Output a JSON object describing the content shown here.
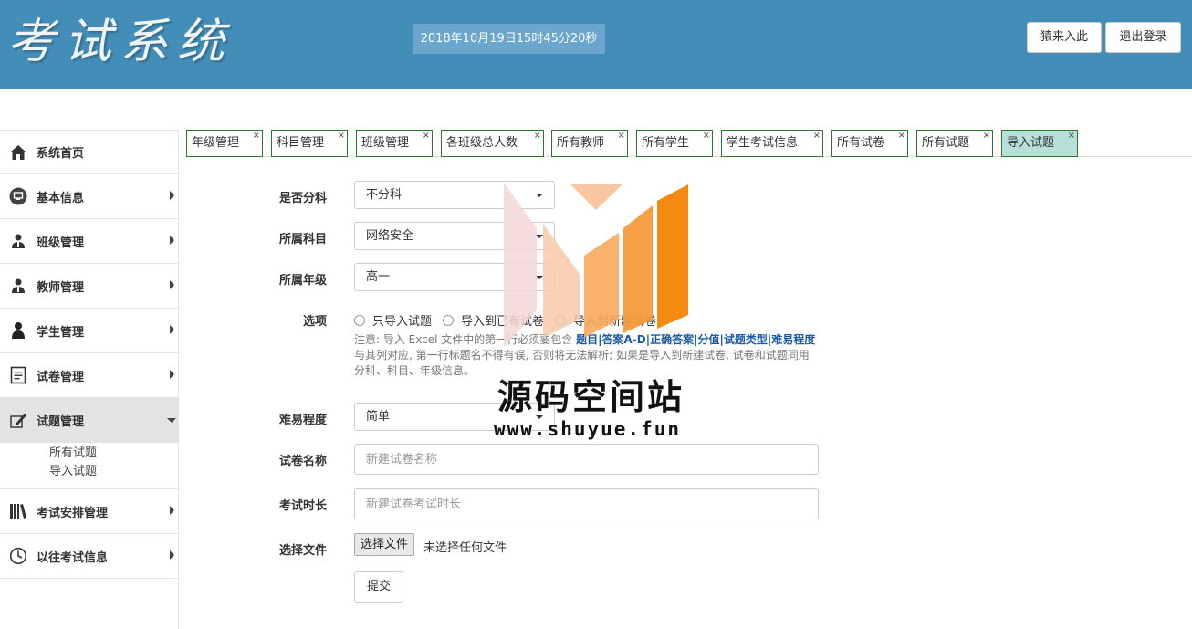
{
  "header": {
    "logo_text": "考试系统",
    "datetime": "2018年10月19日15时45分20秒",
    "enter_button": "猿来入此",
    "logout_button": "退出登录",
    "bg_color": "#438eb9"
  },
  "sidebar": {
    "items": [
      {
        "label": "系统首页",
        "icon": "home-icon"
      },
      {
        "label": "基本信息",
        "icon": "monitor-icon"
      },
      {
        "label": "班级管理",
        "icon": "users-icon"
      },
      {
        "label": "教师管理",
        "icon": "users-icon"
      },
      {
        "label": "学生管理",
        "icon": "user-icon"
      },
      {
        "label": "试卷管理",
        "icon": "document-icon"
      },
      {
        "label": "试题管理",
        "icon": "edit-icon"
      },
      {
        "label": "考试安排管理",
        "icon": "books-icon"
      },
      {
        "label": "以往考试信息",
        "icon": "clock-icon"
      }
    ],
    "submenu": [
      "所有试题",
      "导入试题"
    ]
  },
  "tabs": [
    {
      "label": "年级管理"
    },
    {
      "label": "科目管理"
    },
    {
      "label": "班级管理"
    },
    {
      "label": "各班级总人数"
    },
    {
      "label": "所有教师"
    },
    {
      "label": "所有学生"
    },
    {
      "label": "学生考试信息"
    },
    {
      "label": "所有试卷"
    },
    {
      "label": "所有试题"
    },
    {
      "label": "导入试题"
    }
  ],
  "tab_close": "×",
  "form": {
    "split_label": "是否分科",
    "split_value": "不分科",
    "subject_label": "所属科目",
    "subject_value": "网络安全",
    "grade_label": "所属年级",
    "grade_value": "高一",
    "option_label": "选项",
    "options": [
      "只导入试题",
      "导入到已有试卷",
      "导入到新建试卷"
    ],
    "note_prefix": "注意: 导入 Excel 文件中的第一行必须要包含",
    "note_fields": "题目|答案A-D|正确答案|分值|试题类型|难易程度",
    "note_suffix": "与其列对应, 第一行标题名不得有误, 否则将无法解析; 如果是导入到新建试卷, 试卷和试题同用 分科、科目、年级信息。",
    "difficulty_label": "难易程度",
    "difficulty_value": "简单",
    "paper_name_label": "试卷名称",
    "paper_name_placeholder": "新建试卷名称",
    "duration_label": "考试时长",
    "duration_placeholder": "新建试卷考试时长",
    "file_label": "选择文件",
    "file_button": "选择文件",
    "file_status": "未选择任何文件",
    "submit": "提交"
  },
  "watermark": {
    "title": "源码空间站",
    "url": "www.shuyue.fun"
  }
}
